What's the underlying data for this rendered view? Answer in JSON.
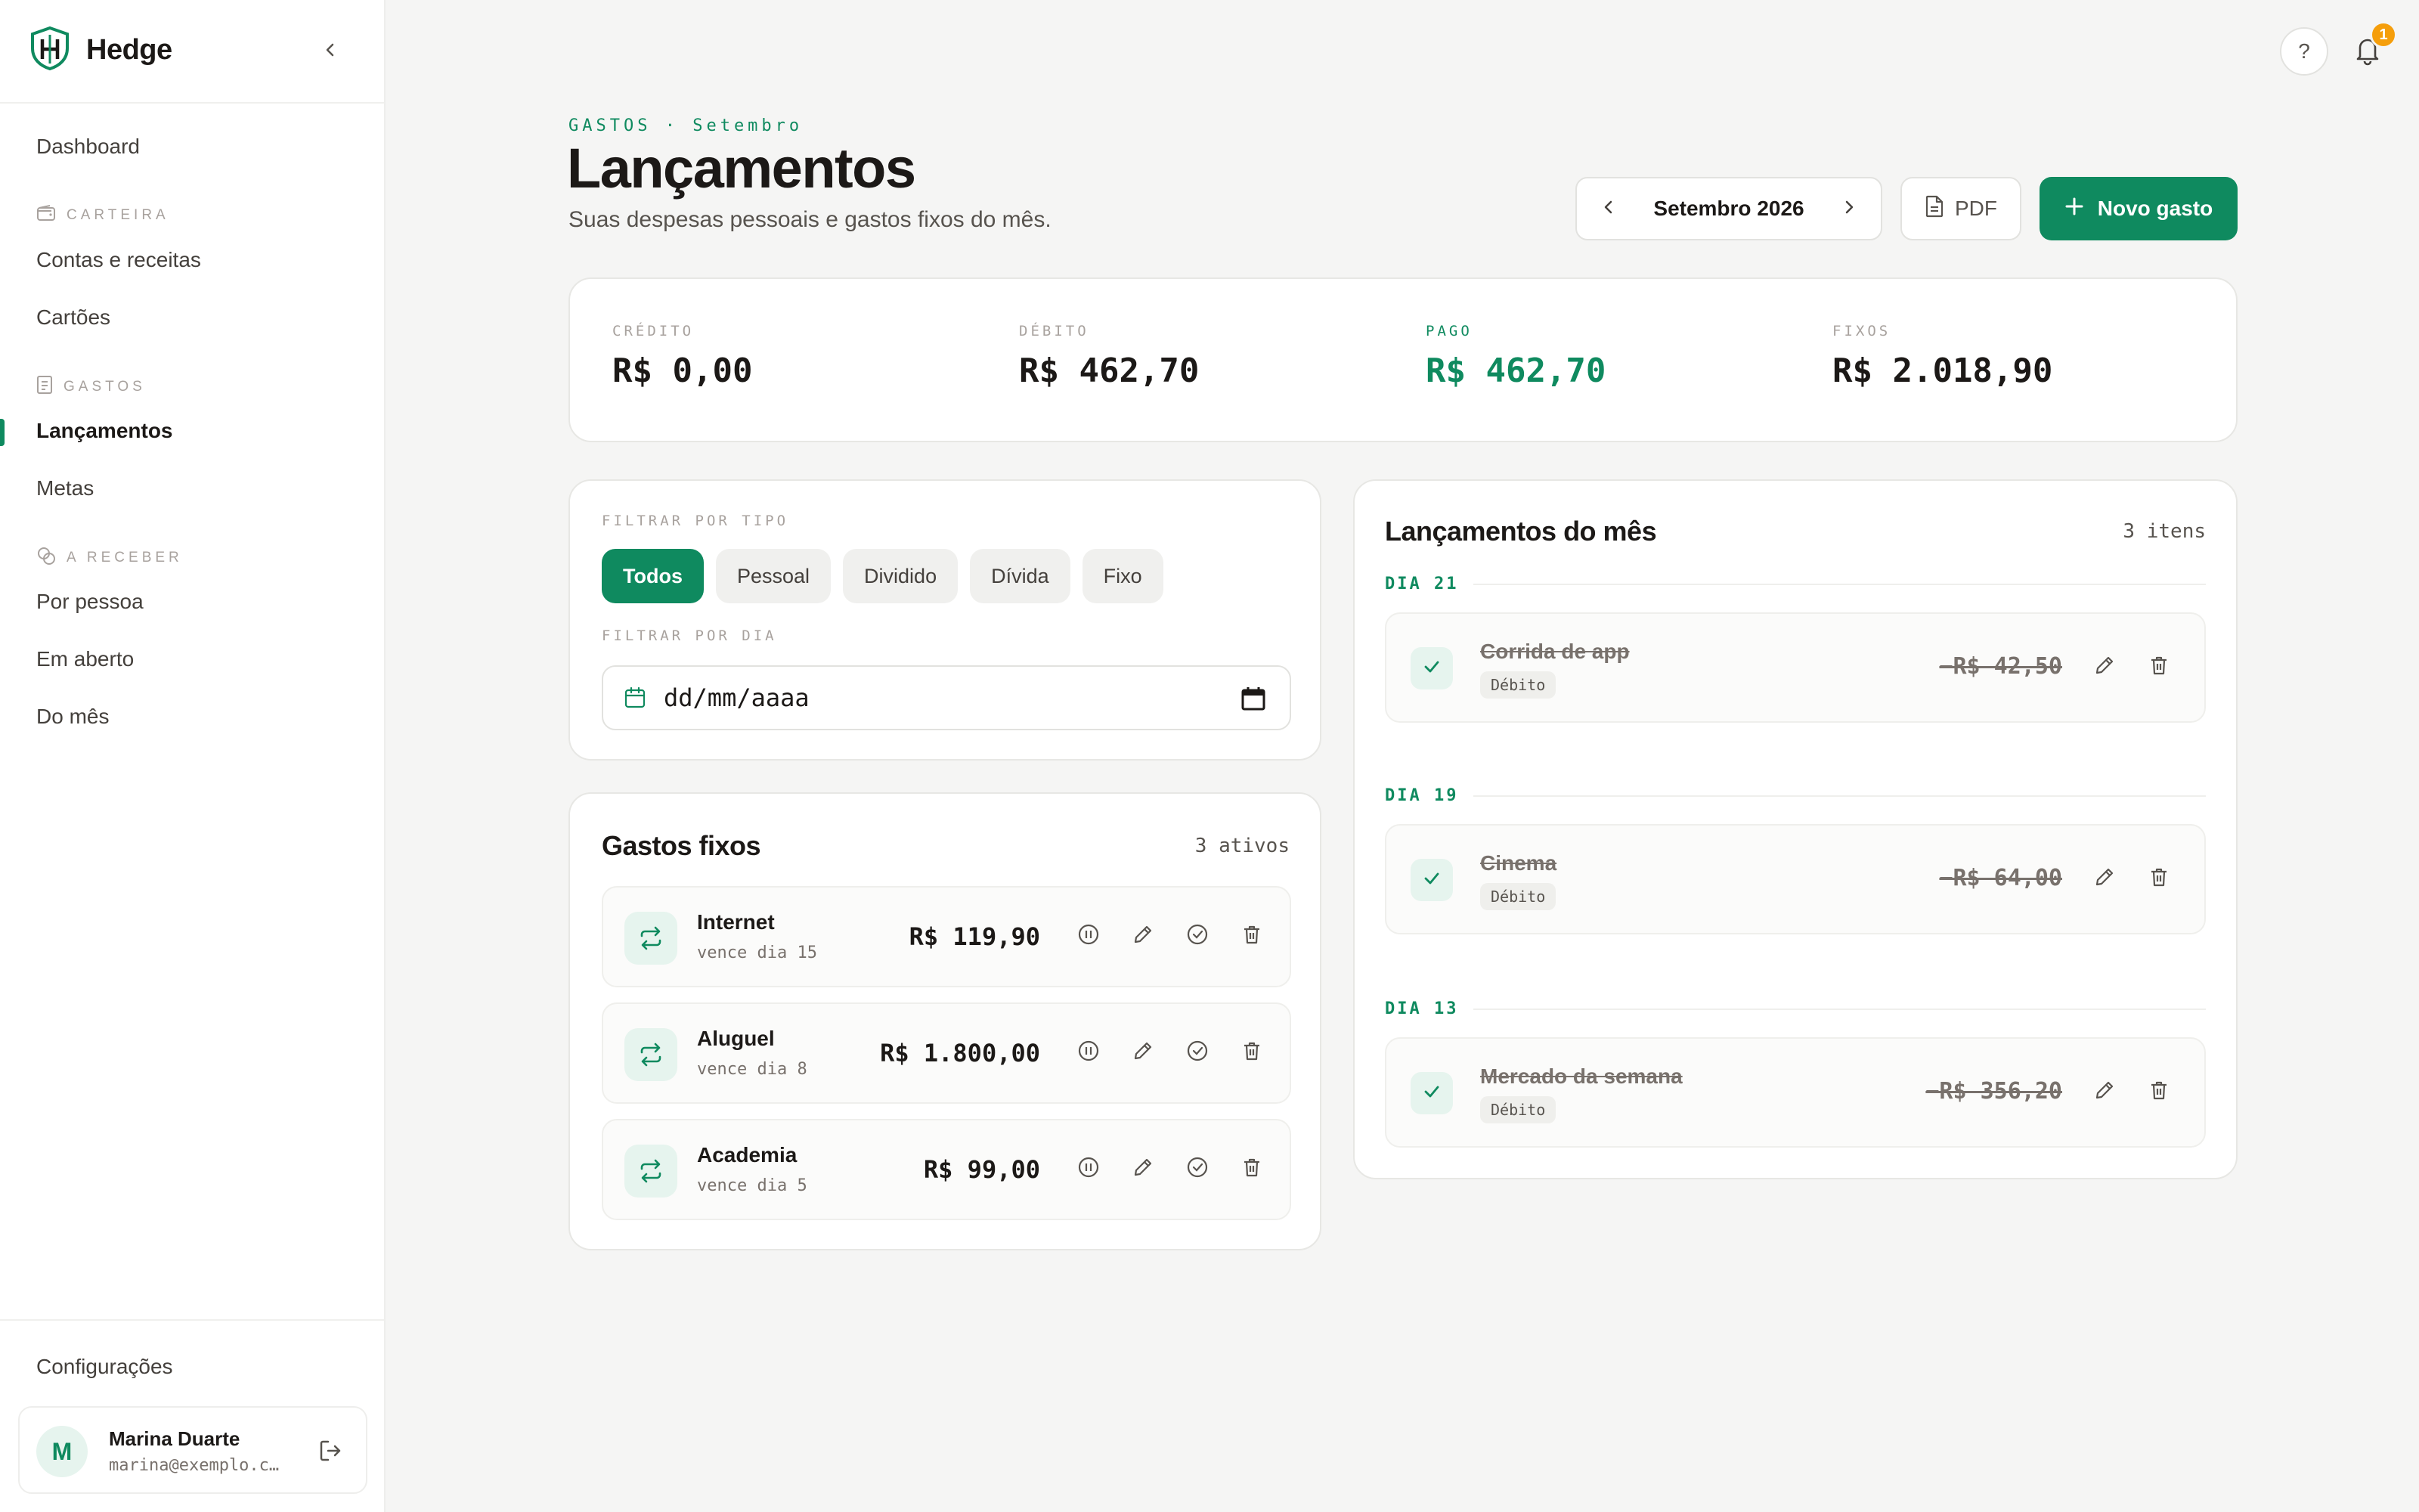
{
  "sidebar": {
    "brand": "Hedge",
    "dashboard": "Dashboard",
    "sections": [
      {
        "label": "CARTEIRA",
        "items": [
          "Contas e receitas",
          "Cartões"
        ]
      },
      {
        "label": "GASTOS",
        "items": [
          "Lançamentos",
          "Metas"
        ]
      },
      {
        "label": "A RECEBER",
        "items": [
          "Por pessoa",
          "Em aberto",
          "Do mês"
        ]
      }
    ],
    "active_item": "Lançamentos",
    "settings": "Configurações",
    "user": {
      "initial": "M",
      "name": "Marina Duarte",
      "email": "marina@exemplo.c…"
    }
  },
  "topbar": {
    "help": "?",
    "notification_count": "1"
  },
  "header": {
    "eyebrow": "GASTOS · Setembro",
    "title": "Lançamentos",
    "subtitle": "Suas despesas pessoais e gastos fixos do mês.",
    "month": "Setembro 2026",
    "pdf_label": "PDF",
    "new_label": "Novo gasto"
  },
  "summary": [
    {
      "label": "CRÉDITO",
      "value": "R$ 0,00"
    },
    {
      "label": "DÉBITO",
      "value": "R$ 462,70"
    },
    {
      "label": "PAGO",
      "value": "R$ 462,70"
    },
    {
      "label": "FIXOS",
      "value": "R$ 2.018,90"
    }
  ],
  "filters": {
    "type_label": "FILTRAR POR TIPO",
    "types": [
      "Todos",
      "Pessoal",
      "Dividido",
      "Dívida",
      "Fixo"
    ],
    "active_type": "Todos",
    "day_label": "FILTRAR POR DIA",
    "day_placeholder": "dd/mm/aaaa"
  },
  "fixos": {
    "title": "Gastos fixos",
    "count": "3 ativos",
    "items": [
      {
        "name": "Internet",
        "due": "vence dia 15",
        "amount": "R$ 119,90"
      },
      {
        "name": "Aluguel",
        "due": "vence dia 8",
        "amount": "R$ 1.800,00"
      },
      {
        "name": "Academia",
        "due": "vence dia 5",
        "amount": "R$ 99,00"
      }
    ]
  },
  "lancamentos": {
    "title": "Lançamentos do mês",
    "count": "3 itens",
    "groups": [
      {
        "day": "DIA 21",
        "name": "Corrida de app",
        "tag": "Débito",
        "amount": "−R$ 42,50",
        "paid": true
      },
      {
        "day": "DIA 19",
        "name": "Cinema",
        "tag": "Débito",
        "amount": "−R$ 64,00",
        "paid": true
      },
      {
        "day": "DIA 13",
        "name": "Mercado da semana",
        "tag": "Débito",
        "amount": "−R$ 356,20",
        "paid": true
      }
    ]
  },
  "colors": {
    "accent": "#0f8a5f",
    "badge": "#f59e0b",
    "background": "#f5f5f4"
  }
}
